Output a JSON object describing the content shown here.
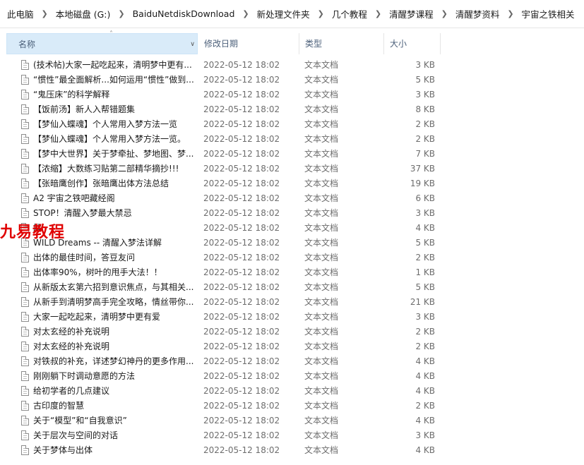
{
  "breadcrumb": [
    "此电脑",
    "本地磁盘 (G:)",
    "BaiduNetdiskDownload",
    "新处理文件夹",
    "几个教程",
    "清醒梦课程",
    "清醒梦资料",
    "宇宙之铁相关"
  ],
  "columns": {
    "name": "名称",
    "date": "修改日期",
    "type": "类型",
    "size": "大小"
  },
  "watermark": "九易教程",
  "files": [
    {
      "name": "(技术帖)大家一起吃起来，清明梦中更有...",
      "date": "2022-05-12 18:02",
      "type": "文本文档",
      "size": "3 KB"
    },
    {
      "name": "“惯性”最全面解析...如何运用“惯性”做到...",
      "date": "2022-05-12 18:02",
      "type": "文本文档",
      "size": "5 KB"
    },
    {
      "name": "“鬼压床”的科学解释",
      "date": "2022-05-12 18:02",
      "type": "文本文档",
      "size": "3 KB"
    },
    {
      "name": "【饭前汤】新人入帮错题集",
      "date": "2022-05-12 18:02",
      "type": "文本文档",
      "size": "8 KB"
    },
    {
      "name": "【梦仙入蝶魂】个人常用入梦方法一览",
      "date": "2022-05-12 18:02",
      "type": "文本文档",
      "size": "2 KB"
    },
    {
      "name": "【梦仙入蝶魂】个人常用入梦方法一览。",
      "date": "2022-05-12 18:02",
      "type": "文本文档",
      "size": "2 KB"
    },
    {
      "name": "【梦中大世界】关于梦牵扯、梦地图、梦...",
      "date": "2022-05-12 18:02",
      "type": "文本文档",
      "size": "7 KB"
    },
    {
      "name": "【浓缩】大数练习贴第二部精华摘抄!!!",
      "date": "2022-05-12 18:02",
      "type": "文本文档",
      "size": "37 KB"
    },
    {
      "name": "【张暗鹰创作】张暗鹰出体方法总结",
      "date": "2022-05-12 18:02",
      "type": "文本文档",
      "size": "19 KB"
    },
    {
      "name": "A2 宇宙之铁吧藏经阁",
      "date": "2022-05-12 18:02",
      "type": "文本文档",
      "size": "6 KB"
    },
    {
      "name": "STOP！清醒入梦最大禁忌",
      "date": "2022-05-12 18:02",
      "type": "文本文档",
      "size": "3 KB"
    },
    {
      "name": "解",
      "date": "2022-05-12 18:02",
      "type": "文本文档",
      "size": "4 KB"
    },
    {
      "name": "WILD Dreams -- 清醒入梦法详解",
      "date": "2022-05-12 18:02",
      "type": "文本文档",
      "size": "5 KB"
    },
    {
      "name": "出体的最佳时间，答豆友问",
      "date": "2022-05-12 18:02",
      "type": "文本文档",
      "size": "2 KB"
    },
    {
      "name": "出体率90%，树叶的甩手大法！！",
      "date": "2022-05-12 18:02",
      "type": "文本文档",
      "size": "1 KB"
    },
    {
      "name": "从新版太玄第六招到意识焦点，与其相关...",
      "date": "2022-05-12 18:02",
      "type": "文本文档",
      "size": "5 KB"
    },
    {
      "name": "从新手到清明梦高手完全攻略，情丝带你...",
      "date": "2022-05-12 18:02",
      "type": "文本文档",
      "size": "21 KB"
    },
    {
      "name": "大家一起吃起来，清明梦中更有爱",
      "date": "2022-05-12 18:02",
      "type": "文本文档",
      "size": "3 KB"
    },
    {
      "name": "对太玄经的补充说明",
      "date": "2022-05-12 18:02",
      "type": "文本文档",
      "size": "2 KB"
    },
    {
      "name": "对太玄经的补充说明",
      "date": "2022-05-12 18:02",
      "type": "文本文档",
      "size": "2 KB"
    },
    {
      "name": "对铁叔的补充，详述梦幻神丹的更多作用...",
      "date": "2022-05-12 18:02",
      "type": "文本文档",
      "size": "4 KB"
    },
    {
      "name": "刚刚躺下时调动意愿的方法",
      "date": "2022-05-12 18:02",
      "type": "文本文档",
      "size": "4 KB"
    },
    {
      "name": "给初学者的几点建议",
      "date": "2022-05-12 18:02",
      "type": "文本文档",
      "size": "4 KB"
    },
    {
      "name": "古印度的智慧",
      "date": "2022-05-12 18:02",
      "type": "文本文档",
      "size": "2 KB"
    },
    {
      "name": "关于“模型”和“自我意识”",
      "date": "2022-05-12 18:02",
      "type": "文本文档",
      "size": "4 KB"
    },
    {
      "name": "关于层次与空间的对话",
      "date": "2022-05-12 18:02",
      "type": "文本文档",
      "size": "3 KB"
    },
    {
      "name": "关于梦体与出体",
      "date": "2022-05-12 18:02",
      "type": "文本文档",
      "size": "4 KB"
    }
  ]
}
